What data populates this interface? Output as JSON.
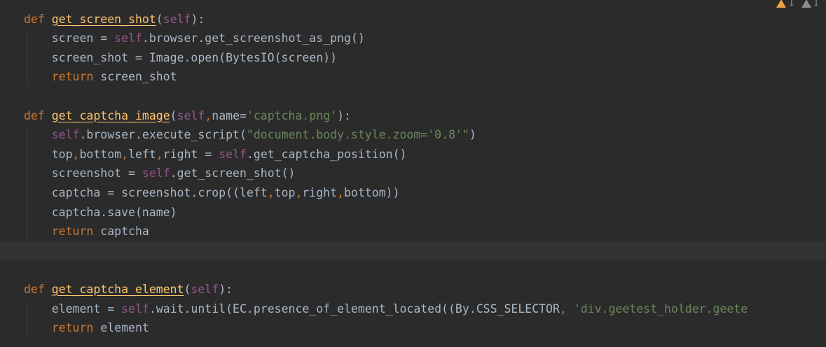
{
  "colors": {
    "background": "#2b2b2b",
    "current_line": "#323232",
    "keyword": "#cc7832",
    "function_name": "#ffc66d",
    "self": "#94558d",
    "string": "#6a8759",
    "plain": "#a9b7c6",
    "warning": "#e8a33d"
  },
  "inspections": {
    "warnings_icon": "warning-triangle-icon",
    "warnings_count": "1",
    "weak_warnings_icon": "weak-warning-triangle-icon",
    "weak_warnings_count": "1"
  },
  "code_lines": [
    [
      [
        "kw",
        "def "
      ],
      [
        "fn",
        "get_screen_shot"
      ],
      [
        "pl",
        "("
      ],
      [
        "self",
        "self"
      ],
      [
        "pl",
        "):"
      ]
    ],
    [
      [
        "pl",
        "    screen = "
      ],
      [
        "self",
        "self"
      ],
      [
        "pl",
        ".browser.get_screenshot_as_png()"
      ]
    ],
    [
      [
        "pl",
        "    screen_shot = Image.open(BytesIO(screen))"
      ]
    ],
    [
      [
        "kw",
        "    return "
      ],
      [
        "pl",
        "screen_shot"
      ]
    ],
    [],
    [
      [
        "kw",
        "def "
      ],
      [
        "fn",
        "get_captcha_image"
      ],
      [
        "pl",
        "("
      ],
      [
        "self",
        "self"
      ],
      [
        "comma",
        ","
      ],
      [
        "pl",
        "name="
      ],
      [
        "str",
        "'captcha.png'"
      ],
      [
        "pl",
        "):"
      ]
    ],
    [
      [
        "pl",
        "    "
      ],
      [
        "self",
        "self"
      ],
      [
        "pl",
        ".browser.execute_script("
      ],
      [
        "str",
        "\"document.body.style.zoom='0.8'\""
      ],
      [
        "pl",
        ")"
      ]
    ],
    [
      [
        "pl",
        "    top"
      ],
      [
        "comma",
        ","
      ],
      [
        "pl",
        "bottom"
      ],
      [
        "comma",
        ","
      ],
      [
        "pl",
        "left"
      ],
      [
        "comma",
        ","
      ],
      [
        "pl",
        "right = "
      ],
      [
        "self",
        "self"
      ],
      [
        "pl",
        ".get_captcha_position()"
      ]
    ],
    [
      [
        "pl",
        "    screenshot = "
      ],
      [
        "self",
        "self"
      ],
      [
        "pl",
        ".get_screen_shot()"
      ]
    ],
    [
      [
        "pl",
        "    captcha = screenshot.crop((left"
      ],
      [
        "comma",
        ","
      ],
      [
        "pl",
        "top"
      ],
      [
        "comma",
        ","
      ],
      [
        "pl",
        "right"
      ],
      [
        "comma",
        ","
      ],
      [
        "pl",
        "bottom))"
      ]
    ],
    [
      [
        "pl",
        "    captcha.save(name)"
      ]
    ],
    [
      [
        "kw",
        "    return "
      ],
      [
        "pl",
        "captcha"
      ]
    ],
    [],
    [],
    [
      [
        "kw",
        "def "
      ],
      [
        "fn",
        "get_captcha_element"
      ],
      [
        "pl",
        "("
      ],
      [
        "self",
        "self"
      ],
      [
        "pl",
        "):"
      ]
    ],
    [
      [
        "pl",
        "    element = "
      ],
      [
        "self",
        "self"
      ],
      [
        "pl",
        ".wait.until(EC.presence_of_element_located((By.CSS_SELECTOR"
      ],
      [
        "comma",
        ", "
      ],
      [
        "str",
        "'div.geetest_holder.geete"
      ]
    ],
    [
      [
        "kw",
        "    return "
      ],
      [
        "pl",
        "element"
      ]
    ]
  ]
}
